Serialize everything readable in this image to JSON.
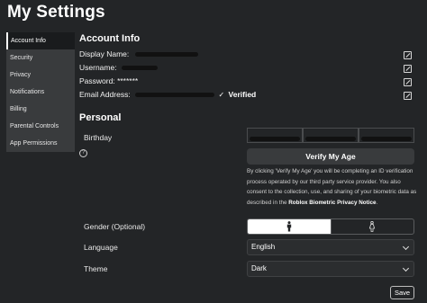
{
  "page": {
    "title": "My Settings"
  },
  "sidebar": {
    "items": [
      {
        "label": "Account Info",
        "active": true
      },
      {
        "label": "Security"
      },
      {
        "label": "Privacy"
      },
      {
        "label": "Notifications"
      },
      {
        "label": "Billing"
      },
      {
        "label": "Parental Controls"
      },
      {
        "label": "App Permissions"
      }
    ]
  },
  "account_info": {
    "title": "Account Info",
    "display_name_label": "Display Name:",
    "username_label": "Username:",
    "password_label": "Password:",
    "password_value": "*******",
    "email_label": "Email Address:",
    "email_status": "Verified"
  },
  "personal": {
    "title": "Personal",
    "birthday_label": "Birthday",
    "verify_button": "Verify My Age",
    "disclaimer_text": "By clicking 'Verify My Age' you will be completing an ID verification process operated by our third party service provider. You also consent to the collection, use, and sharing of your biometric data as described in the ",
    "disclaimer_link": "Roblox Biometric Privacy Notice",
    "disclaimer_end": ".",
    "gender_label": "Gender (Optional)",
    "language_label": "Language",
    "language_value": "English",
    "theme_label": "Theme",
    "theme_value": "Dark",
    "save_button": "Save"
  },
  "icons": {
    "edit": "edit-icon",
    "help": "help-icon",
    "male": "male-icon",
    "female": "female-icon",
    "chevron": "chevron-down-icon",
    "check": "checkmark-icon"
  },
  "colors": {
    "background": "#232527",
    "sidebar": "#393b3d",
    "sidebar_active": "#191b1d",
    "button": "#393b3d"
  }
}
